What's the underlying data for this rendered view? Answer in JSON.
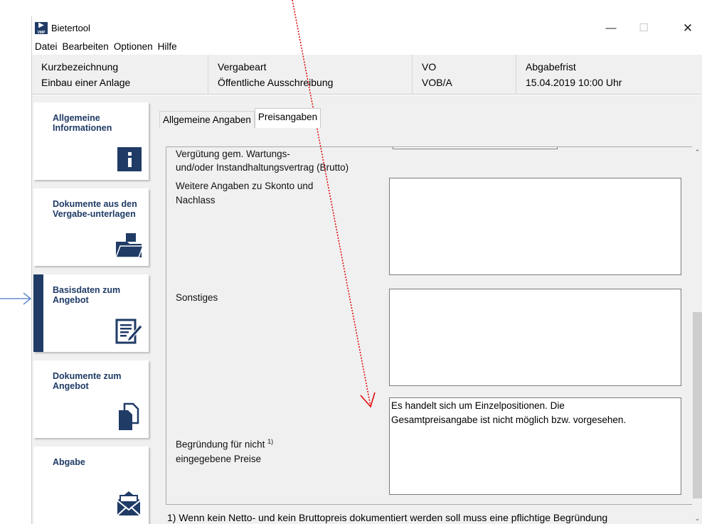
{
  "window": {
    "title": "Bietertool",
    "icon_text": "VMP",
    "minimize_glyph": "—",
    "maximize_glyph": "☐",
    "close_glyph": "✕"
  },
  "menu": [
    "Datei",
    "Bearbeiten",
    "Optionen",
    "Hilfe"
  ],
  "header": {
    "kurz_label": "Kurzbezeichnung",
    "kurz_value": "Einbau einer Anlage",
    "vergabeart_label": "Vergabeart",
    "vergabeart_value": "Öffentliche Ausschreibung",
    "vo_label": "VO",
    "vo_value": "VOB/A",
    "abgabe_label": "Abgabefrist",
    "abgabe_value": "15.04.2019 10:00 Uhr"
  },
  "sidebar": {
    "items": [
      {
        "label": "Allgemeine Informationen",
        "icon": "info-icon"
      },
      {
        "label": "Dokumente aus den Vergabe-unterlagen",
        "icon": "folder-icon"
      },
      {
        "label": "Basisdaten zum Angebot",
        "icon": "edit-document-icon",
        "active": true
      },
      {
        "label": "Dokumente zum Angebot",
        "icon": "documents-icon"
      },
      {
        "label": "Abgabe",
        "icon": "envelope-icon"
      }
    ]
  },
  "tabs": [
    "Allgemeine Angaben",
    "Preisangaben"
  ],
  "active_tab": "Preisangaben",
  "form": {
    "verguetung_label": "Vergütung gem. Wartungs-\nund/oder Instandhaltungsvertrag (Brutto)",
    "skonto_label": "Weitere Angaben zu Skonto und\nNachlass",
    "skonto_value": "",
    "sonstiges_label": "Sonstiges",
    "sonstiges_value": "",
    "begruendung_label_line1": "Begründung für nicht",
    "begruendung_sup": "1)",
    "begruendung_label_line2": "eingegebene Preise",
    "begruendung_value": "Es handelt sich um Einzelpositionen. Die\nGesamtpreisangabe ist nicht möglich bzw. vorgesehen."
  },
  "footnote": "1) Wenn kein Netto- und kein Bruttopreis dokumentiert werden soll muss eine pflichtige Begründung",
  "colors": {
    "brand": "#1f3b66",
    "annotation_blue": "#4a78c2",
    "annotation_red": "#e00000"
  }
}
